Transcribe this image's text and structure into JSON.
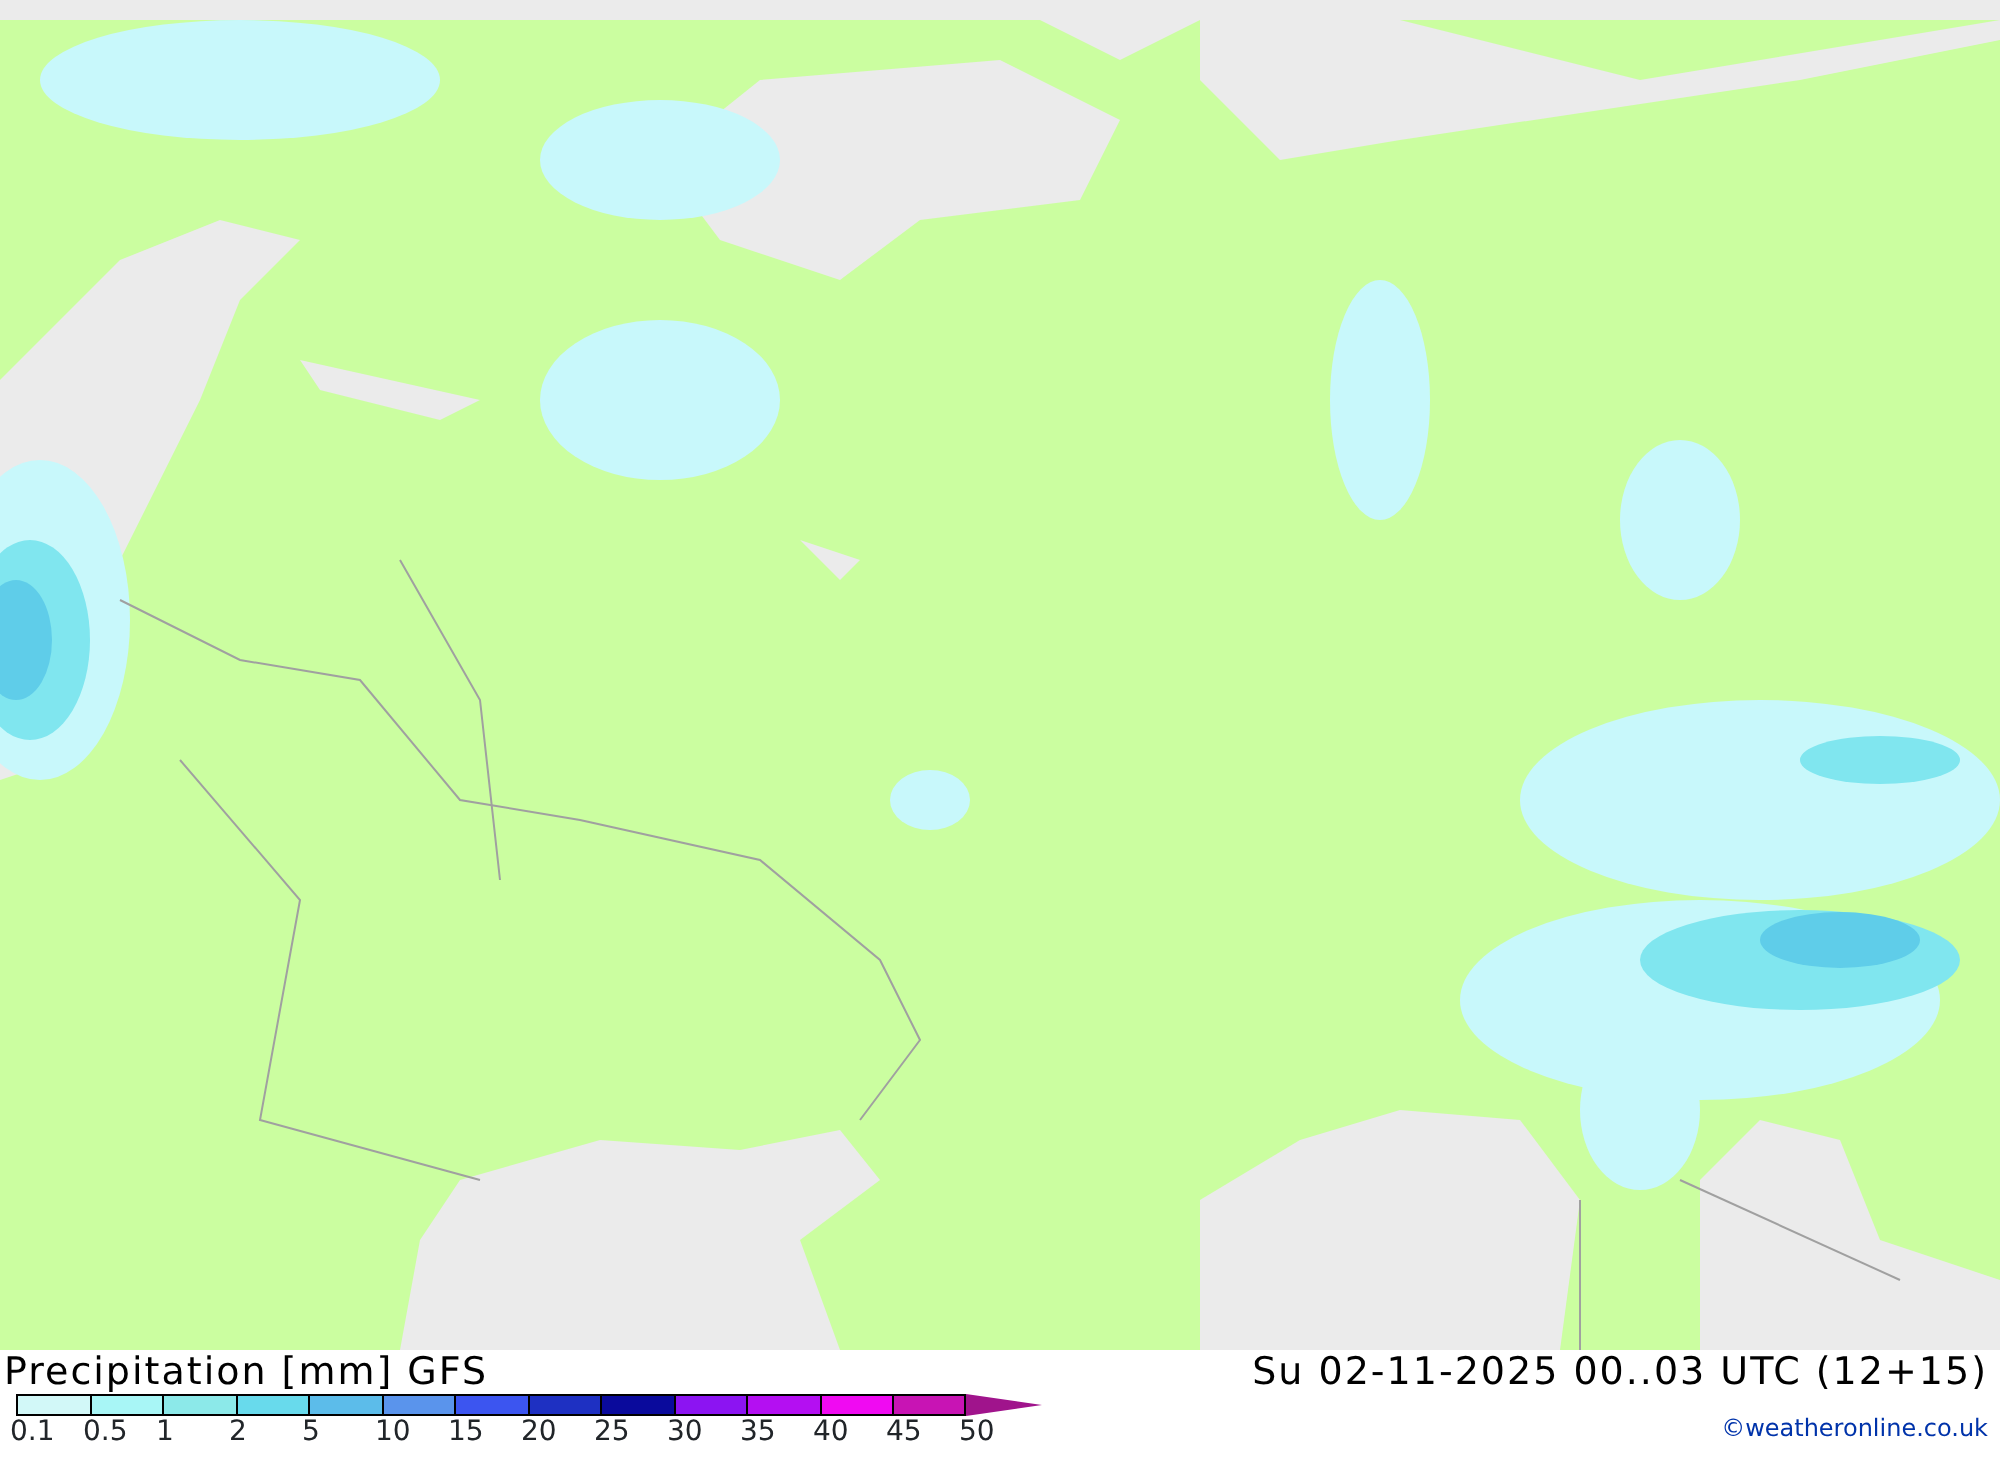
{
  "map": {
    "kind": "precipitation-map"
  },
  "footer": {
    "title": "Precipitation [mm] GFS",
    "valid_time": "Su 02-11-2025 00..03 UTC (12+15)",
    "credit": "©weatheronline.co.uk"
  },
  "legend": [
    {
      "label": "0.1",
      "color": "#d2f8f8"
    },
    {
      "label": "0.5",
      "color": "#a8f6f6"
    },
    {
      "label": "1",
      "color": "#8ce9e9"
    },
    {
      "label": "2",
      "color": "#68daec"
    },
    {
      "label": "5",
      "color": "#5cbcea"
    },
    {
      "label": "10",
      "color": "#5a94ec"
    },
    {
      "label": "15",
      "color": "#3c55f0"
    },
    {
      "label": "20",
      "color": "#1e30c2"
    },
    {
      "label": "25",
      "color": "#0a0a9c"
    },
    {
      "label": "30",
      "color": "#8c14f2"
    },
    {
      "label": "35",
      "color": "#b40ff2"
    },
    {
      "label": "40",
      "color": "#f00af2"
    },
    {
      "label": "45",
      "color": "#c814b4"
    }
  ],
  "legend_end": {
    "label": "50",
    "color": "#a0148c"
  }
}
